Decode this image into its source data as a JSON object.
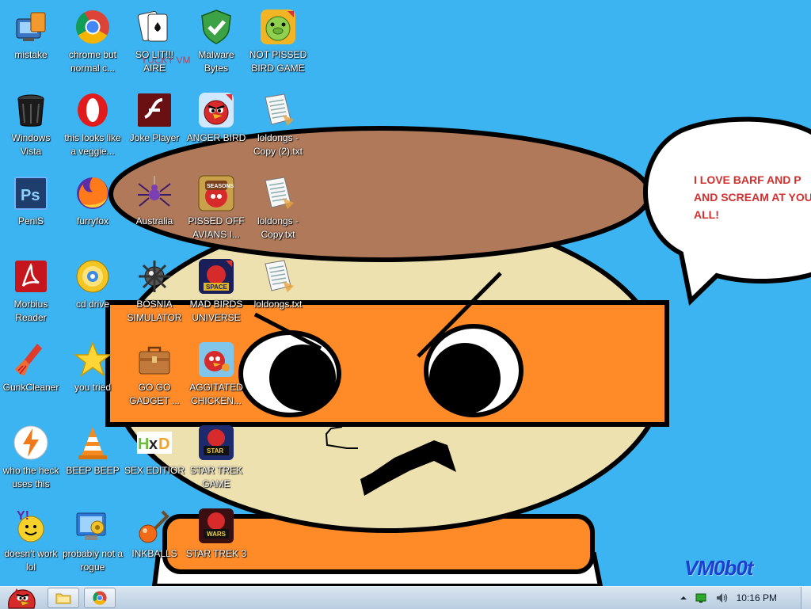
{
  "speech_bubble": {
    "line1": "I LOVE BARF AND P",
    "line2": "AND SCREAM AT YOU",
    "line3": "ALL!"
  },
  "watermark": "VM0b0t",
  "wallpaper_overlay_text": "YUCKY VM",
  "desktop_icons": [
    {
      "label": "mistake",
      "icon": "system-settings-icon"
    },
    {
      "label": "chrome but normal c...",
      "icon": "chrome-icon"
    },
    {
      "label": "SO LIT!!! AIRE",
      "icon": "cards-icon"
    },
    {
      "label": "Malware Bytes",
      "icon": "shield-check-icon"
    },
    {
      "label": "NOT PISSED BIRD GAME",
      "icon": "green-pig-icon"
    },
    {
      "label": "Windows Vista",
      "icon": "trash-bin-icon"
    },
    {
      "label": "this looks like a veggie...",
      "icon": "opera-icon"
    },
    {
      "label": "Joke Player",
      "icon": "flash-icon"
    },
    {
      "label": "ANGER BIRD",
      "icon": "red-bird-icon"
    },
    {
      "label": "loldongs - Copy (2).txt",
      "icon": "text-file-icon"
    },
    {
      "label": "PeniS",
      "icon": "photoshop-icon"
    },
    {
      "label": "furryfox",
      "icon": "firefox-icon"
    },
    {
      "label": "Australia",
      "icon": "spider-icon"
    },
    {
      "label": "PISSED OFF AVIANS I...",
      "icon": "seasons-bird-icon"
    },
    {
      "label": "loldongs - Copy.txt",
      "icon": "text-file-icon"
    },
    {
      "label": "Morbius Reader",
      "icon": "pdf-reader-icon"
    },
    {
      "label": "cd drive",
      "icon": "cd-icon"
    },
    {
      "label": "BOSNIA SIMULATOR",
      "icon": "mine-icon"
    },
    {
      "label": "MAD BIRDS UNIVERSE",
      "icon": "space-bird-icon"
    },
    {
      "label": "loldongs.txt",
      "icon": "text-file-icon"
    },
    {
      "label": "GunkCleaner",
      "icon": "broom-icon"
    },
    {
      "label": "you tried",
      "icon": "star-icon"
    },
    {
      "label": "GO GO GADGET ...",
      "icon": "briefcase-icon"
    },
    {
      "label": "AGGITATED CHICKEN...",
      "icon": "bird-chicken-icon"
    },
    {
      "label": "who the heck uses this",
      "icon": "bolt-icon"
    },
    {
      "label": "BEEP BEEP",
      "icon": "traffic-cone-icon"
    },
    {
      "label": "SEX EDITIOR",
      "icon": "hex-editor-icon"
    },
    {
      "label": "STAR TREK GAME",
      "icon": "star-wars-bird-icon"
    },
    {
      "label": "doesn't work lol",
      "icon": "yahoo-messenger-icon"
    },
    {
      "label": "probably not a rogue",
      "icon": "gears-monitor-icon"
    },
    {
      "label": "INKBALLS",
      "icon": "ink-ball-icon"
    },
    {
      "label": "STAR TREK 3",
      "icon": "star-wars-bird-2-icon"
    }
  ],
  "taskbar": {
    "start_icon": "angry-bird-start-icon",
    "pinned": [
      {
        "icon": "folder-icon"
      },
      {
        "icon": "chrome-icon"
      }
    ],
    "tray": {
      "show_hidden_icon": "up-arrow-icon",
      "network_icon": "network-icon",
      "volume_icon": "speaker-icon",
      "clock": "10:16 PM"
    }
  }
}
